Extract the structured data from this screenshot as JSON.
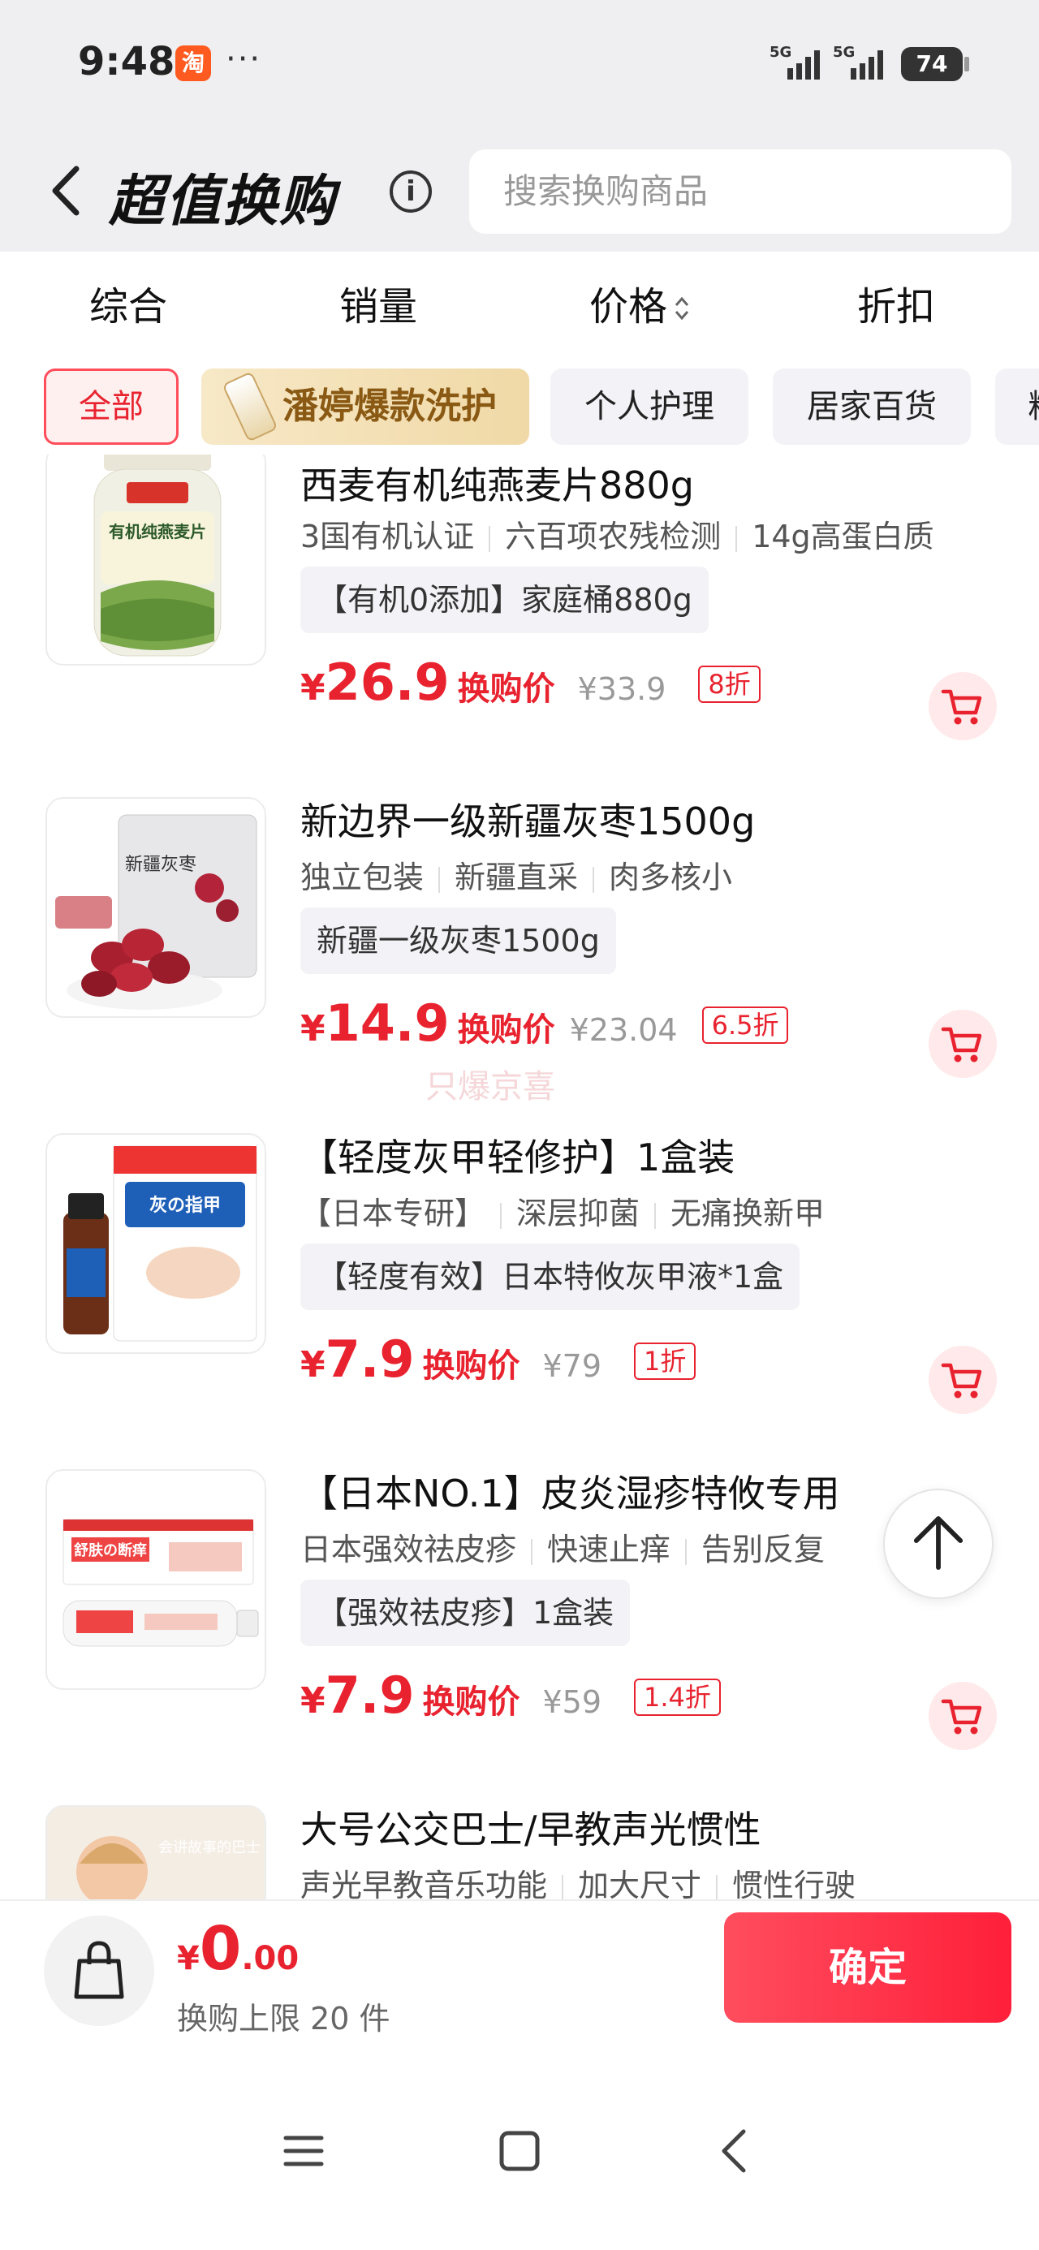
{
  "status_bar": {
    "time": "9:48",
    "app_icon_glyph": "淘",
    "more": "···",
    "signal_1": "5G",
    "signal_2": "5G",
    "battery": "74"
  },
  "header": {
    "title": "超值换购",
    "info_glyph": "i",
    "search_placeholder": "搜索换购商品"
  },
  "sort_tabs": [
    {
      "label": "综合"
    },
    {
      "label": "销量"
    },
    {
      "label": "价格"
    },
    {
      "label": "折扣"
    }
  ],
  "category_chips": [
    {
      "label": "全部",
      "active": true
    },
    {
      "label": "潘婷爆款洗护",
      "promo": true
    },
    {
      "label": "个人护理"
    },
    {
      "label": "居家百货"
    },
    {
      "label": "粮"
    }
  ],
  "currency": "¥",
  "price_label": "换购价",
  "watermark": "只爆京喜",
  "products": [
    {
      "title": "西麦有机纯燕麦片880g",
      "tags": [
        "3国有机认证",
        "六百项农残检测",
        "14g高蛋白质"
      ],
      "spec": "【有机0添加】家庭桶880g",
      "price": "26.9",
      "original": "¥33.9",
      "discount": "8折",
      "thumb_text": "有机纯燕麦片"
    },
    {
      "title": "新边界一级新疆灰枣1500g",
      "tags": [
        "独立包装",
        "新疆直采",
        "肉多核小"
      ],
      "spec": "新疆一级灰枣1500g",
      "price": "14.9",
      "original": "¥23.04",
      "discount": "6.5折",
      "thumb_text": "新疆灰枣"
    },
    {
      "title": "【轻度灰甲轻修护】1盒装",
      "tags": [
        "【日本专研】",
        "深层抑菌",
        "无痛换新甲"
      ],
      "spec": "【轻度有效】日本特攸灰甲液*1盒",
      "price": "7.9",
      "original": "¥79",
      "discount": "1折",
      "thumb_text": "灰の指甲"
    },
    {
      "title": "【日本NO.1】皮炎湿疹特攸专用",
      "tags": [
        "日本强效祛皮疹",
        "快速止痒",
        "告别反复"
      ],
      "spec": "【强效祛皮疹】1盒装",
      "price": "7.9",
      "original": "¥59",
      "discount": "1.4折",
      "thumb_text": "舒肤の断痒"
    },
    {
      "title": "大号公交巴士/早教声光惯性",
      "tags": [
        "声光早教音乐功能",
        "加大尺寸",
        "惯性行驶"
      ],
      "thumb_text": "会讲故事的巴士"
    }
  ],
  "bottom": {
    "currency": "¥",
    "total_int": "0",
    "total_dec": ".00",
    "limit_text": "换购上限 20 件",
    "confirm_label": "确定"
  },
  "colors": {
    "accent": "#e8232f",
    "chip_bg": "#f3f3f7",
    "header_bg": "#efeff1"
  }
}
